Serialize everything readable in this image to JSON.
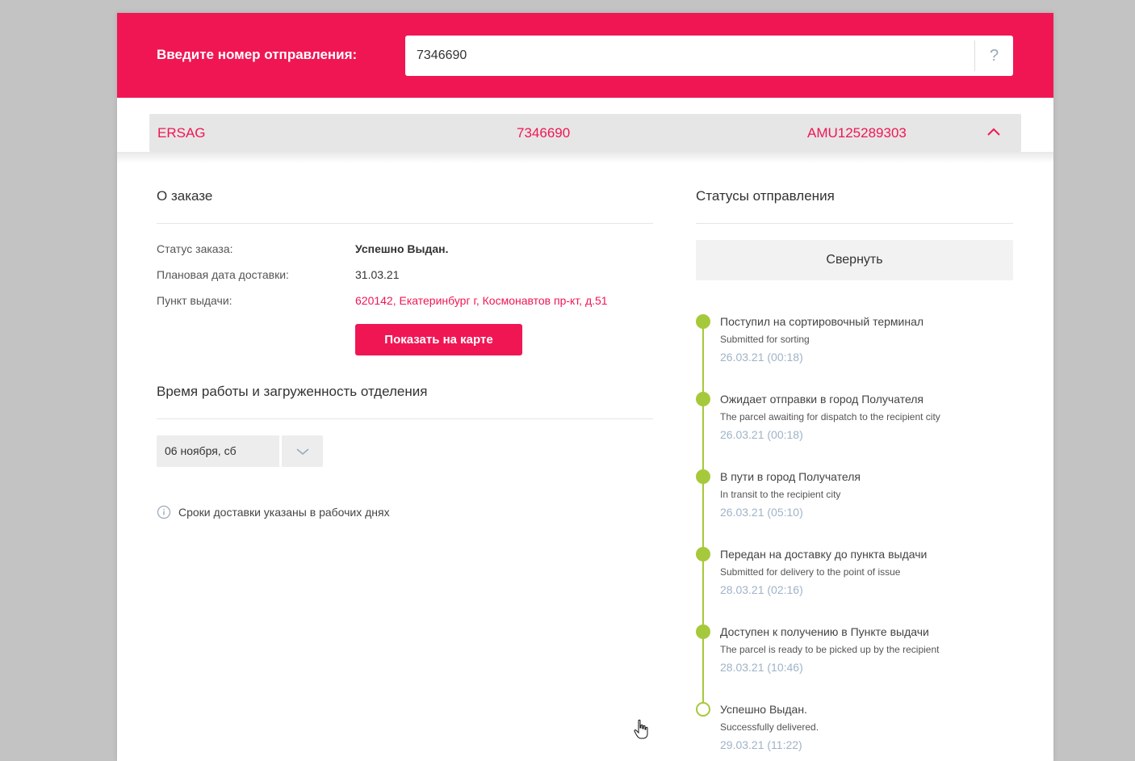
{
  "header": {
    "label": "Введите номер отправления:",
    "search_value": "7346690",
    "help_label": "?"
  },
  "summary": {
    "sender": "ERSAG",
    "order_number": "7346690",
    "tracking_code": "AMU125289303"
  },
  "order": {
    "title": "О заказе",
    "rows": [
      {
        "label": "Статус заказа:",
        "value": "Успешно Выдан."
      },
      {
        "label": "Плановая дата доставки:",
        "value": "31.03.21"
      },
      {
        "label": "Пункт выдачи:",
        "value": "620142, Екатеринбург г, Космонавтов пр-кт, д.51"
      }
    ],
    "map_button": "Показать на карте"
  },
  "hours": {
    "title": "Время работы и загруженность отделения",
    "selected_date": "06 ноября, сб",
    "note": "Сроки доставки указаны в рабочих днях"
  },
  "statuses": {
    "title": "Статусы отправления",
    "collapse_button": "Свернуть",
    "events": [
      {
        "title": "Поступил на сортировочный терминал",
        "subtitle": "Submitted for sorting",
        "date": "26.03.21 (00:18)"
      },
      {
        "title": "Ожидает отправки в город Получателя",
        "subtitle": "The parcel awaiting for dispatch to the recipient city",
        "date": "26.03.21 (00:18)"
      },
      {
        "title": "В пути в город Получателя",
        "subtitle": "In transit to the recipient city",
        "date": "26.03.21 (05:10)"
      },
      {
        "title": "Передан на доставку до пункта выдачи",
        "subtitle": "Submitted for delivery to the point of issue",
        "date": "28.03.21 (02:16)"
      },
      {
        "title": "Доступен к получению в Пункте выдачи",
        "subtitle": "The parcel is ready to be picked up by the recipient",
        "date": "28.03.21 (10:46)"
      },
      {
        "title": "Успешно Выдан.",
        "subtitle": "Successfully delivered.",
        "date": "29.03.21 (11:22)"
      }
    ]
  },
  "colors": {
    "accent": "#f01654",
    "timeline": "#a6c93b",
    "date_text": "#9fb3c8"
  },
  "icons": [
    "chevron-up-icon",
    "chevron-down-icon",
    "info-icon",
    "help-icon",
    "hand-cursor-icon"
  ]
}
